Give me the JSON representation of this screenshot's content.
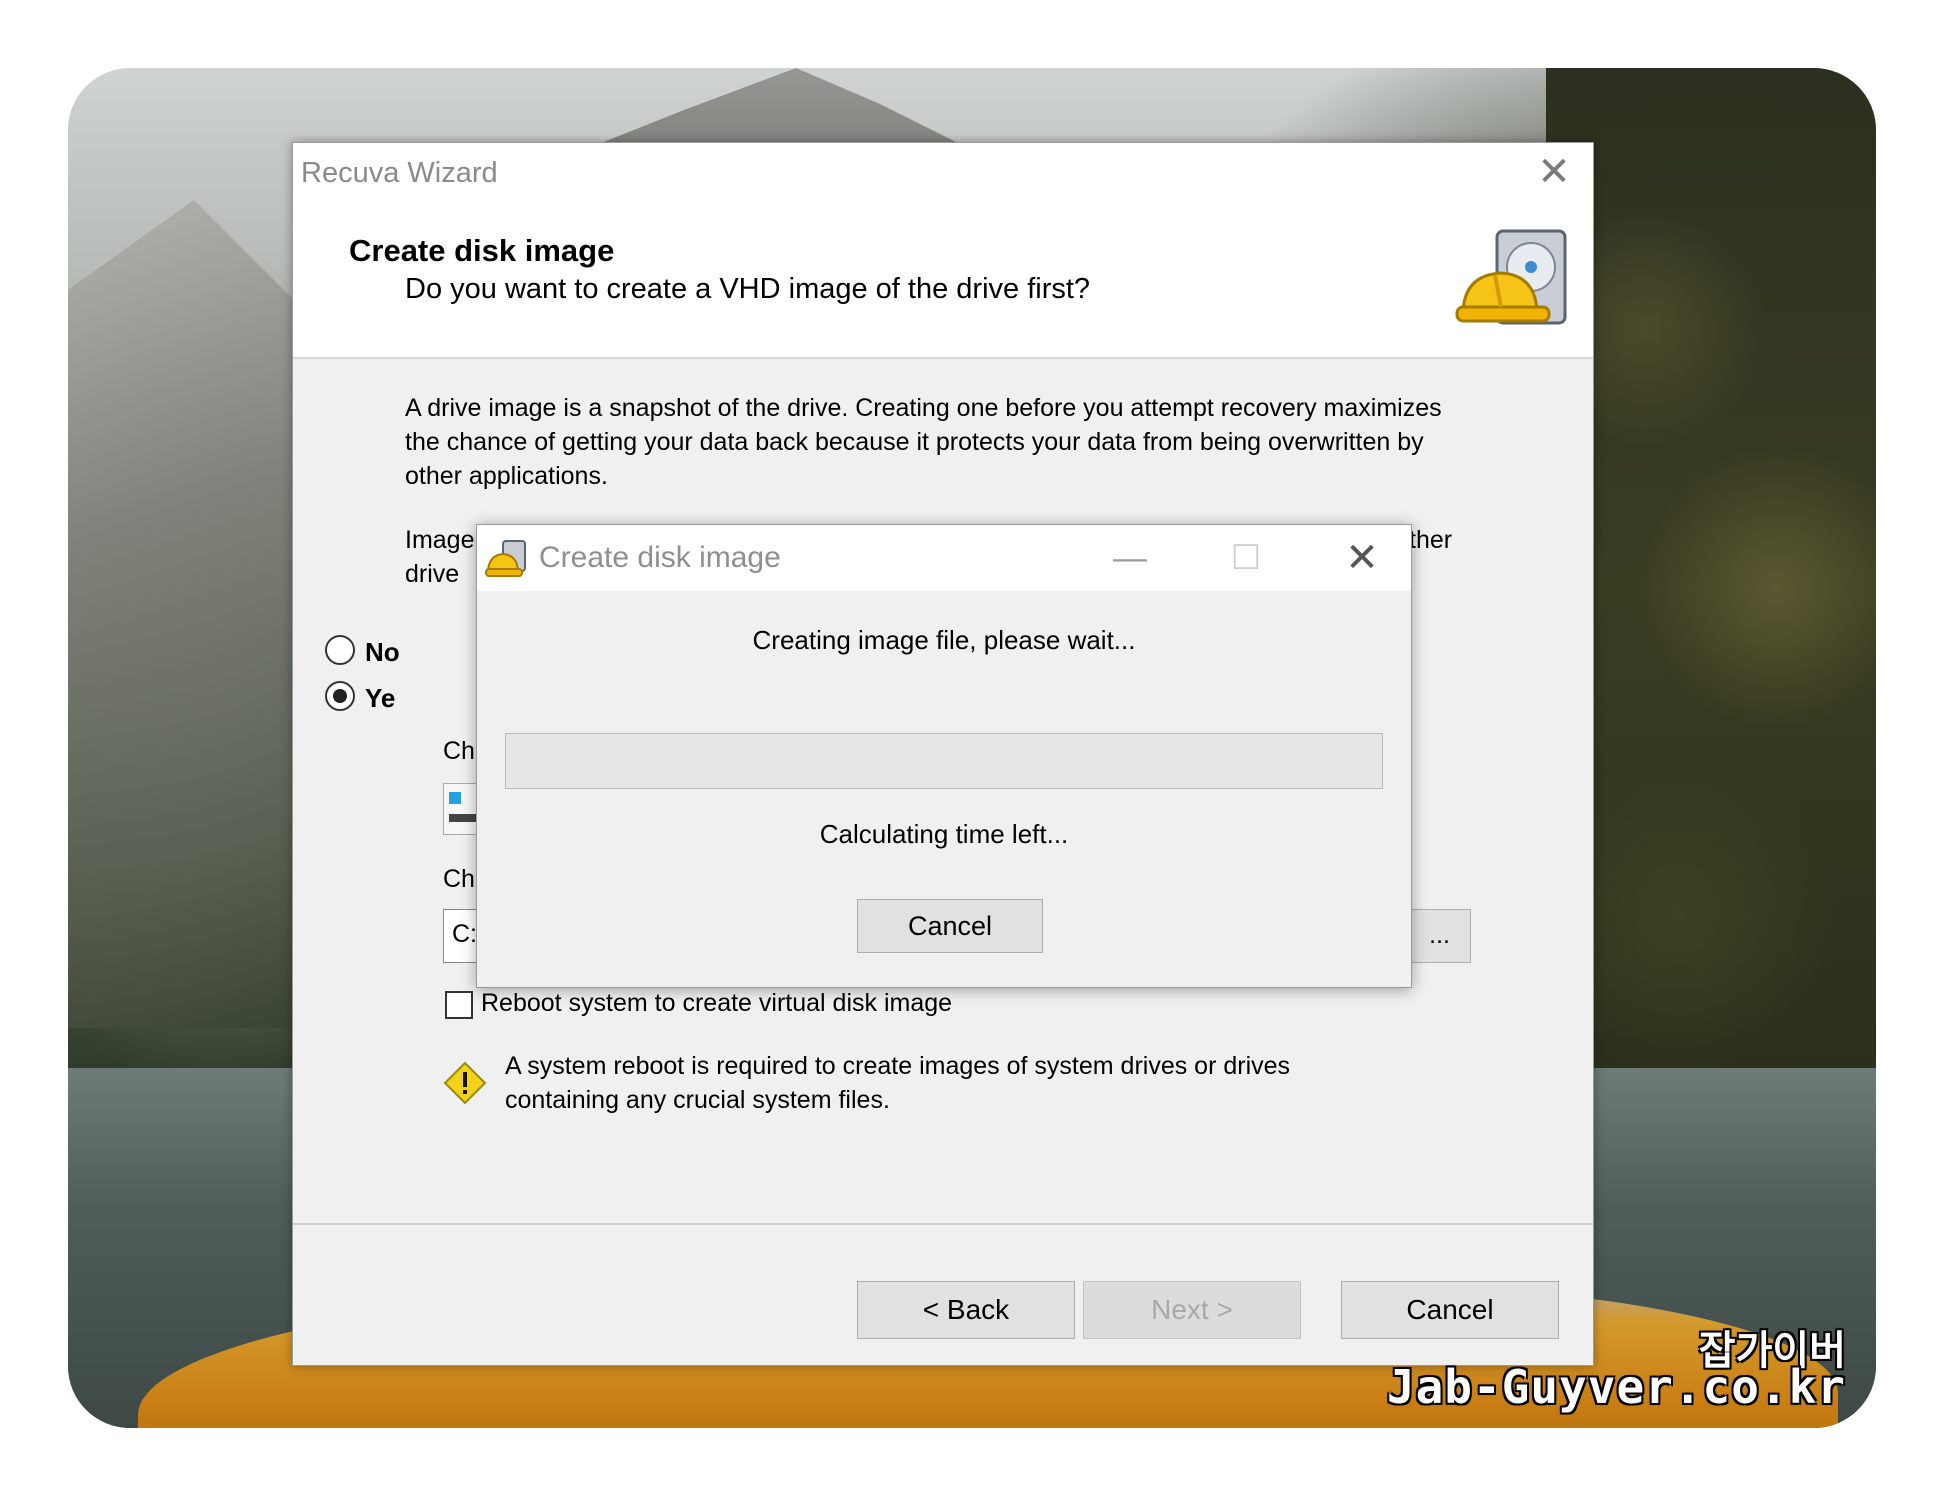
{
  "wizard": {
    "window_title": "Recuva Wizard",
    "heading": "Create disk image",
    "subheading": "Do you want to create a VHD image of the drive first?",
    "description": "A drive image is a snapshot of the drive. Creating one before you attempt recovery maximizes the chance of getting your data back because it protects your data from being overwritten by other applications.",
    "image_label_line1": "Image",
    "image_label_line2": "drive",
    "image_label_right": "ther",
    "radio_no_label": "No",
    "radio_yes_label": "Ye",
    "radio_selected": "yes",
    "choose_label_1": "Ch",
    "choose_label_2": "Ch",
    "path_value": "C:",
    "browse_label": "...",
    "reboot_checkbox_label": "Reboot system to create virtual disk image",
    "reboot_checked": false,
    "warning_text": "A system reboot is required to create images of system drives or drives containing any crucial system files.",
    "back_label": "< Back",
    "next_label": "Next >",
    "cancel_label": "Cancel"
  },
  "modal": {
    "title": "Create disk image",
    "status": "Creating image file, please wait...",
    "progress": 0,
    "time_text": "Calculating time left...",
    "cancel_label": "Cancel"
  },
  "watermark": {
    "korean": "잡가이버",
    "site": "Jab-Guyver.co.kr"
  },
  "colors": {
    "window_bg": "#f0f0f0",
    "progress_fill": "#06b025",
    "warning_yellow": "#f3d21a"
  }
}
